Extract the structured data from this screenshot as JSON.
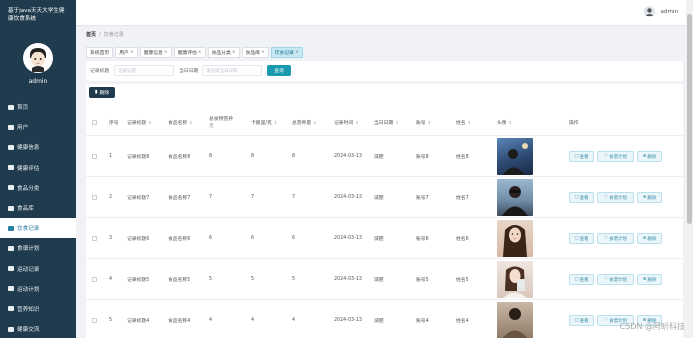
{
  "sidebar": {
    "brand": "基于java天天大学生健康饮食系统",
    "user_name": "admin",
    "items": [
      {
        "label": "首页",
        "icon": "home-icon"
      },
      {
        "label": "用户",
        "icon": "user-icon"
      },
      {
        "label": "健康信息",
        "icon": "heart-icon"
      },
      {
        "label": "健康评估",
        "icon": "chart-icon"
      },
      {
        "label": "食品分类",
        "icon": "category-icon"
      },
      {
        "label": "食品库",
        "icon": "food-icon"
      },
      {
        "label": "饮食记录",
        "icon": "record-icon",
        "active": true
      },
      {
        "label": "食谱计划",
        "icon": "plan-icon"
      },
      {
        "label": "运动记录",
        "icon": "sport-icon"
      },
      {
        "label": "运动计划",
        "icon": "sport-plan-icon"
      },
      {
        "label": "营养知识",
        "icon": "book-icon"
      },
      {
        "label": "健康交流",
        "icon": "chat-icon"
      }
    ]
  },
  "header": {
    "user": "admin"
  },
  "breadcrumb": {
    "home": "首页",
    "separator": "/",
    "current": "饮食记录"
  },
  "tags": [
    {
      "label": "系统首页",
      "closable": false
    },
    {
      "label": "用户",
      "closable": true
    },
    {
      "label": "健康信息",
      "closable": true
    },
    {
      "label": "健康评估",
      "closable": true
    },
    {
      "label": "食品分类",
      "closable": true
    },
    {
      "label": "食品库",
      "closable": true
    },
    {
      "label": "饮食记录",
      "closable": true,
      "active": true
    }
  ],
  "search": {
    "title_label": "记录标题",
    "title_placeholder": "记录标题",
    "date_label": "当日日期",
    "date_placeholder": "请选择当日日期",
    "button": "查询"
  },
  "toolbar": {
    "delete_label": "删除"
  },
  "table": {
    "headers": [
      "序号",
      "记录标题",
      "食品名称",
      "总食物营养",
      "卡路里/克",
      "总营养量",
      "记录时间",
      "当日日期",
      "账号",
      "姓名",
      "头像",
      "操作"
    ],
    "header_sub": "克",
    "ops": {
      "view": "查看",
      "plan": "食谱计划",
      "delete": "删除"
    },
    "rows": [
      {
        "no": "1",
        "title": "记录标题8",
        "food": "食品名称8",
        "total": "8",
        "cal": "8",
        "amount": "8",
        "time": "2024-03-13",
        "date": "减肥",
        "account": "账号8",
        "name": "姓名8"
      },
      {
        "no": "2",
        "title": "记录标题7",
        "food": "食品名称7",
        "total": "7",
        "cal": "7",
        "amount": "7",
        "time": "2024-03-13",
        "date": "减肥",
        "account": "账号7",
        "name": "姓名7"
      },
      {
        "no": "3",
        "title": "记录标题6",
        "food": "食品名称6",
        "total": "6",
        "cal": "6",
        "amount": "6",
        "time": "2024-03-13",
        "date": "减肥",
        "account": "账号6",
        "name": "姓名6"
      },
      {
        "no": "4",
        "title": "记录标题5",
        "food": "食品名称5",
        "total": "5",
        "cal": "5",
        "amount": "5",
        "time": "2024-03-13",
        "date": "减肥",
        "account": "账号5",
        "name": "姓名5"
      },
      {
        "no": "5",
        "title": "记录标题4",
        "food": "食品名称4",
        "total": "4",
        "cal": "4",
        "amount": "4",
        "time": "2024-03-13",
        "date": "减肥",
        "account": "账号4",
        "name": "姓名4"
      }
    ]
  },
  "watermark": "CSDN @阿昕科技",
  "colors": {
    "sidebar": "#1f3b4d",
    "accent": "#1a9aae",
    "active_tag": "#c6e9f4"
  }
}
